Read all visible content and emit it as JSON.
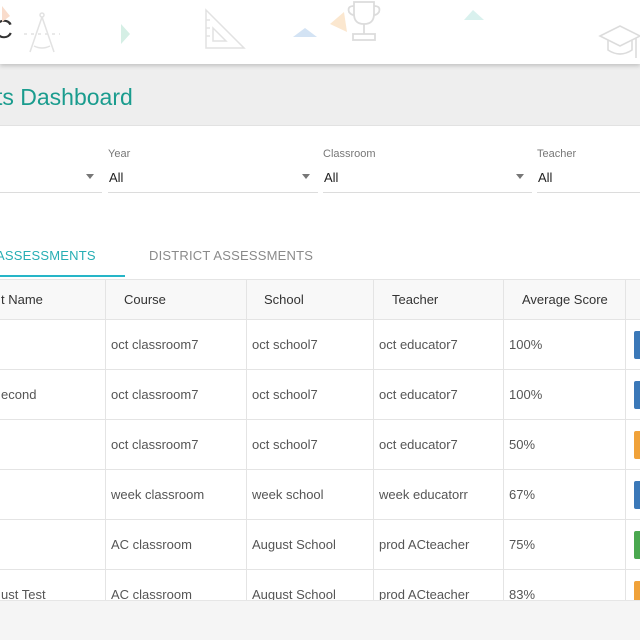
{
  "header": {
    "logo_text": "C",
    "decor_icons": [
      "compass-icon",
      "set-square-icon",
      "trophy-icon",
      "graduation-cap-icon"
    ]
  },
  "title": "ts Dashboard",
  "filters": [
    {
      "label": "",
      "value": ""
    },
    {
      "label": "Year",
      "value": "All"
    },
    {
      "label": "Classroom",
      "value": "All"
    },
    {
      "label": "Teacher",
      "value": "All"
    }
  ],
  "tabs": [
    {
      "label": "ASSESSMENTS",
      "active": true
    },
    {
      "label": "DISTRICT ASSESSMENTS",
      "active": false
    }
  ],
  "table": {
    "columns": [
      "t Name",
      "Course",
      "School",
      "Teacher",
      "Average Score",
      ""
    ],
    "rows": [
      {
        "name": "",
        "course": "oct classroom7",
        "school": "oct school7",
        "teacher": "oct educator7",
        "score": "100%",
        "badge": "#3b78b8"
      },
      {
        "name": "econd",
        "course": "oct classroom7",
        "school": "oct school7",
        "teacher": "oct educator7",
        "score": "100%",
        "badge": "#3b78b8"
      },
      {
        "name": "",
        "course": "oct classroom7",
        "school": "oct school7",
        "teacher": "oct educator7",
        "score": "50%",
        "badge": "#f0a23a"
      },
      {
        "name": "",
        "course": "week classroom",
        "school": "week school",
        "teacher": "week educatorr",
        "score": "67%",
        "badge": "#3b78b8"
      },
      {
        "name": "",
        "course": "AC classroom",
        "school": "August School",
        "teacher": "prod ACteacher",
        "score": "75%",
        "badge": "#4aa84f"
      },
      {
        "name": "ust Test",
        "course": "AC classroom",
        "school": "August School",
        "teacher": "prod ACteacher",
        "score": "83%",
        "badge": "#f0a23a"
      }
    ]
  },
  "colors": {
    "accent": "#1a9c8e",
    "tab_active": "#27aeb4"
  }
}
